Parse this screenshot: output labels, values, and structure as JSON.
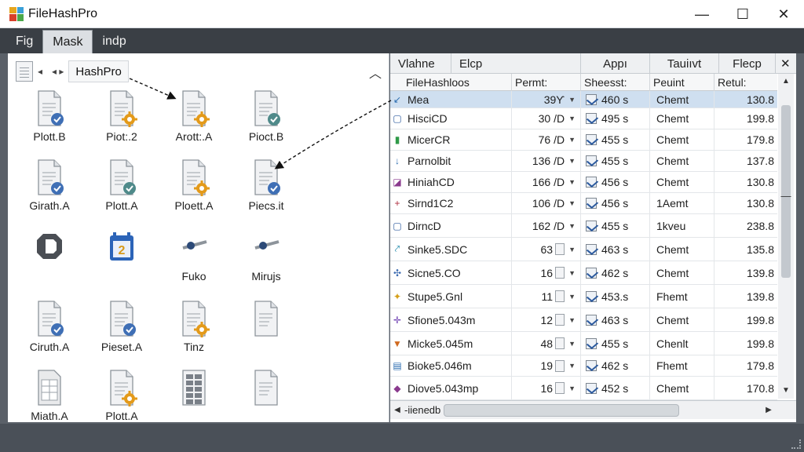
{
  "app": {
    "title": "FileHashPro"
  },
  "window": {
    "minimize": "—",
    "maximize": "☐",
    "close": "✕"
  },
  "menu": {
    "items": [
      {
        "label": "Fig"
      },
      {
        "label": "Mask"
      },
      {
        "label": "indp"
      }
    ]
  },
  "left": {
    "breadcrumb": "HashPro",
    "tiles": [
      {
        "label": "Plott.B",
        "badge": "check"
      },
      {
        "label": "Piot:.2",
        "badge": "gear"
      },
      {
        "label": "Arott:.A",
        "badge": "gear"
      },
      {
        "label": "Pioct.B",
        "badge": "check-teal"
      },
      {
        "label": "Girath.A",
        "badge": "check"
      },
      {
        "label": "Plott.A",
        "badge": "check-teal"
      },
      {
        "label": "Ploett.A",
        "badge": "gear"
      },
      {
        "label": "Piecs.it",
        "badge": "check-pink"
      },
      {
        "label": "",
        "badge": "octagon"
      },
      {
        "label": "",
        "badge": "calendar",
        "num": "2"
      },
      {
        "label": "Fuko",
        "badge": "slider"
      },
      {
        "label": "Mirujs",
        "badge": "slider"
      },
      {
        "label": "Ciruth.A",
        "badge": "check"
      },
      {
        "label": "Pieset.A",
        "badge": "check"
      },
      {
        "label": "Tinz",
        "badge": "gear"
      },
      {
        "label": "",
        "badge": "none"
      },
      {
        "label": "Miath.A",
        "badge": "sheet"
      },
      {
        "label": "Plott.A",
        "badge": "gear"
      },
      {
        "label": "",
        "badge": "grid"
      },
      {
        "label": "",
        "badge": "none"
      }
    ]
  },
  "right": {
    "top_headers": [
      {
        "label": "Vlahne"
      },
      {
        "label": "Elcp"
      },
      {
        "label": "Appı"
      },
      {
        "label": "Tauiıvt"
      },
      {
        "label": "Flecp"
      }
    ],
    "close_glyph": "✕",
    "columns": [
      {
        "label": "FileHashloos"
      },
      {
        "label": "Permt:"
      },
      {
        "label": "Sheesst:"
      },
      {
        "label": "Peuint"
      },
      {
        "label": "Retul:"
      }
    ],
    "rows": [
      {
        "icon": "↙",
        "icon_color": "#2c6db0",
        "name": "Mea",
        "perm": "39Ƴ",
        "perm_ctrl": "dd",
        "sheet": "460 s",
        "pad": "Chemt",
        "ret": "130.8",
        "selected": true
      },
      {
        "icon": "▢",
        "icon_color": "#2c5a9e",
        "name": "HisciCD",
        "perm": "30 /D",
        "perm_ctrl": "dd",
        "sheet": "495 s",
        "pad": "Chemt",
        "ret": "199.8"
      },
      {
        "icon": "▮",
        "icon_color": "#2f9a48",
        "name": "MicerCR",
        "perm": "76 /D",
        "perm_ctrl": "dd",
        "sheet": "455 s",
        "pad": "Chemt",
        "ret": "179.8"
      },
      {
        "icon": "↓",
        "icon_color": "#2c6db0",
        "name": "Parnolbit",
        "perm": "136 /D",
        "perm_ctrl": "dd",
        "sheet": "455 s",
        "pad": "Chemt",
        "ret": "137.8"
      },
      {
        "icon": "◪",
        "icon_color": "#8a3a8e",
        "name": "HiniahCD",
        "perm": "166 /D",
        "perm_ctrl": "dd",
        "sheet": "456 s",
        "pad": "Chemt",
        "ret": "130.8"
      },
      {
        "icon": "+",
        "icon_color": "#b03040",
        "name": "Sirnd1C2",
        "perm": "106 /D",
        "perm_ctrl": "dd",
        "sheet": "456 s",
        "pad": "1Aemt",
        "ret": "130.8"
      },
      {
        "icon": "▢",
        "icon_color": "#2c5a9e",
        "name": "DirncD",
        "perm": "162 /D",
        "perm_ctrl": "dd",
        "sheet": "455 s",
        "pad": "1kveu",
        "ret": "238.8"
      },
      {
        "icon": "⤤",
        "icon_color": "#2a8fb0",
        "name": "Sinke5.SDC",
        "perm": "63",
        "perm_ctrl": "doc",
        "sheet": "463 s",
        "pad": "Chemt",
        "ret": "135.8"
      },
      {
        "icon": "✣",
        "icon_color": "#3a6ab0",
        "name": "Sicne5.CO",
        "perm": "16",
        "perm_ctrl": "doc",
        "sheet": "462 s",
        "pad": "Chemt",
        "ret": "139.8"
      },
      {
        "icon": "✦",
        "icon_color": "#d6a01a",
        "name": "Stupe5.Gnl",
        "perm": "11",
        "perm_ctrl": "doc",
        "sheet": "453.s",
        "pad": "Fhemt",
        "ret": "139.8"
      },
      {
        "icon": "✛",
        "icon_color": "#6a3ab0",
        "name": "Sfione5.043m",
        "perm": "12",
        "perm_ctrl": "doc",
        "sheet": "463 s",
        "pad": "Chemt",
        "ret": "199.8"
      },
      {
        "icon": "▼",
        "icon_color": "#d06a20",
        "name": "Micke5.045m",
        "perm": "48",
        "perm_ctrl": "doc",
        "sheet": "455 s",
        "pad": "Chenlt",
        "ret": "199.8"
      },
      {
        "icon": "▤",
        "icon_color": "#2c6db0",
        "name": "Bioke5.046m",
        "perm": "19",
        "perm_ctrl": "doc",
        "sheet": "462 s",
        "pad": "Fhemt",
        "ret": "179.8"
      },
      {
        "icon": "◆",
        "icon_color": "#8a3a8e",
        "name": "Diove5.043mp",
        "perm": "16",
        "perm_ctrl": "doc",
        "sheet": "452 s",
        "pad": "Chemt",
        "ret": "170.8"
      }
    ],
    "scroll_label": "-iienedb",
    "scroll_up": "▲",
    "scroll_down": "▼",
    "scroll_left": "◀",
    "scroll_right": "▶",
    "scroll_hint": "—"
  }
}
